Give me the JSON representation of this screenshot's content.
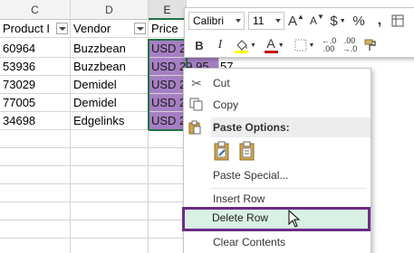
{
  "columns": [
    {
      "letter": "C",
      "header": "Product I"
    },
    {
      "letter": "D",
      "header": "Vendor"
    },
    {
      "letter": "E",
      "header": "Price"
    }
  ],
  "rows": [
    {
      "id": "60964",
      "vendor": "Buzzbean",
      "price": "USD 2"
    },
    {
      "id": "53936",
      "vendor": "Buzzbean",
      "price": "USD 29.95"
    },
    {
      "id": "73029",
      "vendor": "Demidel",
      "price": "USD 2"
    },
    {
      "id": "77005",
      "vendor": "Demidel",
      "price": "USD 2"
    },
    {
      "id": "34698",
      "vendor": "Edgelinks",
      "price": "USD 2"
    }
  ],
  "overflow_cell": "57",
  "mini_toolbar": {
    "font_name": "Calibri",
    "font_size": "11",
    "grow_font": "A",
    "shrink_font": "A",
    "currency": "$",
    "percent": "%",
    "comma": ",",
    "bold": "B",
    "italic": "I",
    "font_color_letter": "A",
    "font_color": "#c00000",
    "fill_color": "#ffff00"
  },
  "context_menu": {
    "cut": "Cut",
    "copy": "Copy",
    "paste_options": "Paste Options:",
    "paste_special": "Paste Special...",
    "insert_row": "Insert Row",
    "delete_row": "Delete Row",
    "clear_contents": "Clear Contents"
  },
  "colors": {
    "selection": "#a57fc3",
    "highlight_border": "#6c2c86",
    "highlight_fill": "#d9f0e4",
    "excel_green": "#217346"
  }
}
